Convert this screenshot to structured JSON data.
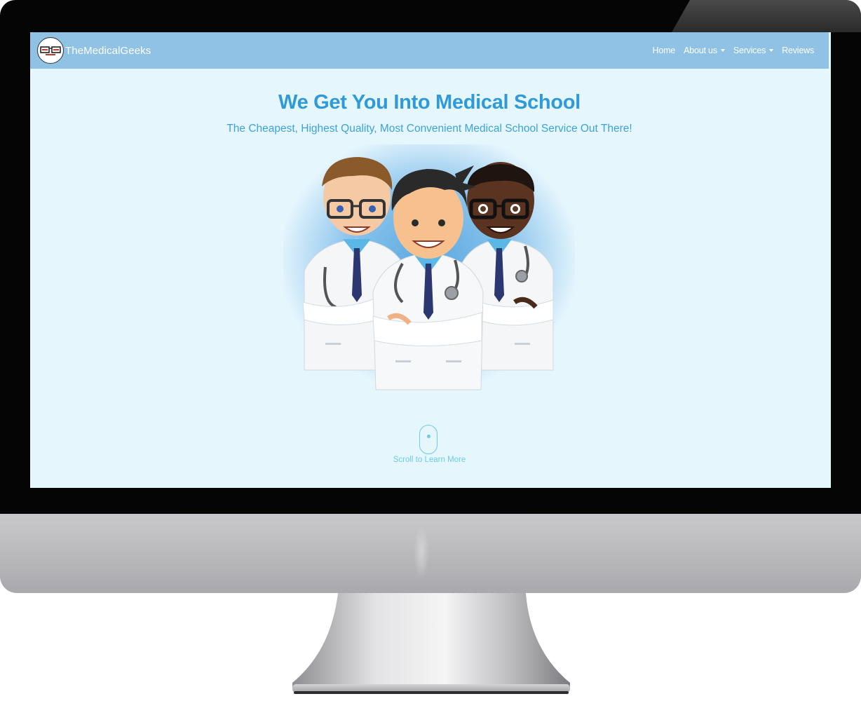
{
  "navbar": {
    "brand": "TheMedicalGeeks",
    "links": [
      {
        "label": "Home"
      },
      {
        "label": "About us"
      },
      {
        "label": "Services"
      },
      {
        "label": "Reviews"
      }
    ]
  },
  "hero": {
    "title": "We Get You Into Medical School",
    "subtitle": "The Cheapest, Highest Quality, Most Convenient Medical School Service Out There!"
  },
  "scroll": {
    "label": "Scroll to Learn More"
  },
  "colors": {
    "navbar": "#8fc2e4",
    "page_bg": "#e6f6fd",
    "title": "#2f9ad9",
    "subtitle": "#3aa3db",
    "scroll_hint": "#6ccbe8"
  },
  "icons": {
    "brand_logo": "glasses-logo-icon",
    "dropdown": "caret-down-icon",
    "scroll": "mouse-scroll-icon"
  }
}
